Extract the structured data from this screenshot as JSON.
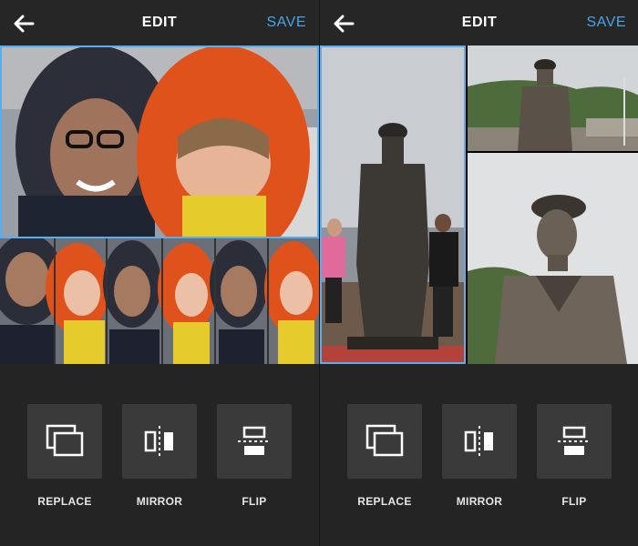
{
  "screens": [
    {
      "header": {
        "back_icon": "arrow-left-icon",
        "title": "EDIT",
        "save": "SAVE"
      },
      "tools": [
        {
          "label": "REPLACE",
          "icon": "replace-icon"
        },
        {
          "label": "MIRROR",
          "icon": "mirror-icon"
        },
        {
          "label": "FLIP",
          "icon": "flip-icon"
        }
      ]
    },
    {
      "header": {
        "back_icon": "arrow-left-icon",
        "title": "EDIT",
        "save": "SAVE"
      },
      "tools": [
        {
          "label": "REPLACE",
          "icon": "replace-icon"
        },
        {
          "label": "MIRROR",
          "icon": "mirror-icon"
        },
        {
          "label": "FLIP",
          "icon": "flip-icon"
        }
      ]
    }
  ],
  "colors": {
    "accent": "#4aa3e8",
    "selection": "#5aaef0",
    "background": "#242424",
    "tile": "#3a3a3a"
  }
}
